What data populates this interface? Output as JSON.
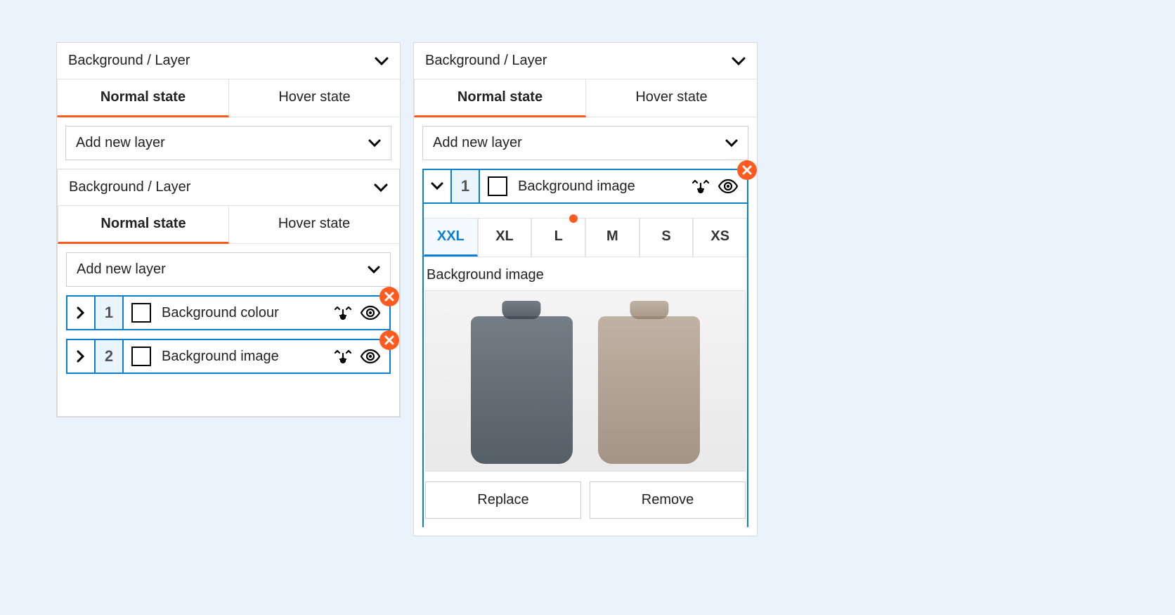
{
  "leftPanel": {
    "header": "Background / Layer",
    "tabs": {
      "normal": "Normal state",
      "hover": "Hover state"
    },
    "addNew": "Add new layer",
    "nested": {
      "header": "Background / Layer",
      "tabs": {
        "normal": "Normal state",
        "hover": "Hover state"
      },
      "addNew": "Add new layer",
      "layers": [
        {
          "num": "1",
          "label": "Background colour"
        },
        {
          "num": "2",
          "label": "Background image"
        }
      ]
    }
  },
  "rightPanel": {
    "header": "Background / Layer",
    "tabs": {
      "normal": "Normal state",
      "hover": "Hover state"
    },
    "addNew": "Add new layer",
    "openLayer": {
      "num": "1",
      "label": "Background image"
    },
    "breakpoints": [
      "XXL",
      "XL",
      "L",
      "M",
      "S",
      "XS"
    ],
    "activeBreakpoint": "XXL",
    "dotBreakpoint": "L",
    "fieldLabel": "Background image",
    "replace": "Replace",
    "remove": "Remove"
  }
}
